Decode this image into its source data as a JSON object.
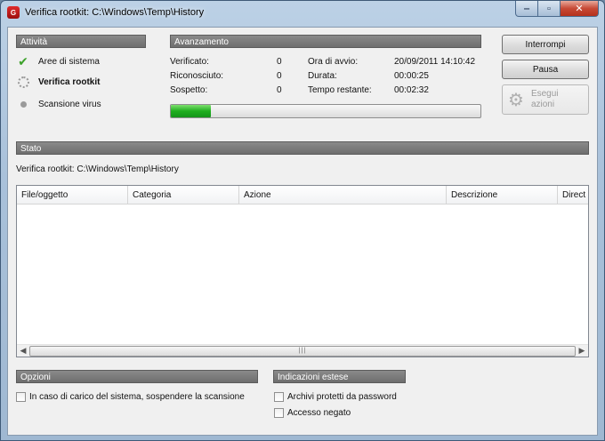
{
  "window": {
    "title": "Verifica rootkit: C:\\Windows\\Temp\\History",
    "app_icon": "shield-icon"
  },
  "activities": {
    "header": "Attività",
    "items": [
      {
        "label": "Aree di sistema",
        "state": "done",
        "icon": "checkmark-icon"
      },
      {
        "label": "Verifica rootkit",
        "state": "running",
        "icon": "spinner-icon"
      },
      {
        "label": "Scansione virus",
        "state": "pending",
        "icon": "dot-icon"
      }
    ]
  },
  "progress": {
    "header": "Avanzamento",
    "verificato_label": "Verificato:",
    "verificato_value": "0",
    "riconosciuto_label": "Riconosciuto:",
    "riconosciuto_value": "0",
    "sospetto_label": "Sospetto:",
    "sospetto_value": "0",
    "start_label": "Ora di avvio:",
    "start_value": "20/09/2011 14:10:42",
    "duration_label": "Durata:",
    "duration_value": "00:00:25",
    "remaining_label": "Tempo restante:",
    "remaining_value": "00:02:32",
    "bar_percent": 13,
    "bar_color": "#1fae1f"
  },
  "buttons": {
    "stop": "Interrompi",
    "pause": "Pausa",
    "run_actions_line1": "Esegui",
    "run_actions_line2": "azioni"
  },
  "status": {
    "header": "Stato",
    "text": "Verifica rootkit: C:\\Windows\\Temp\\History"
  },
  "table": {
    "columns": [
      "File/oggetto",
      "Categoria",
      "Azione",
      "Descrizione",
      "Direct"
    ],
    "rows": []
  },
  "options": {
    "header": "Opzioni",
    "pause_on_load": "In caso di carico del sistema, sospendere la scansione"
  },
  "extended": {
    "header": "Indicazioni estese",
    "password_archives": "Archivi protetti da password",
    "access_denied": "Accesso negato"
  }
}
